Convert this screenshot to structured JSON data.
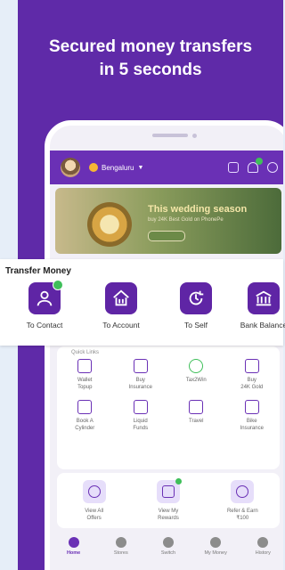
{
  "headline": {
    "line1": "Secured money transfers",
    "line2": "in 5 seconds"
  },
  "phone": {
    "location": "Bengaluru",
    "banner": {
      "title": "This wedding season",
      "subtitle": "buy 24K Best Gold on PhonePe"
    },
    "quick_links_label": "Quick Links",
    "grid_items": [
      {
        "label": "Wallet\nTopup",
        "icon": "wallet-icon"
      },
      {
        "label": "Buy\nInsurance",
        "icon": "shield-icon"
      },
      {
        "label": "Tax2Win",
        "icon": "tax-icon"
      },
      {
        "label": "Buy\n24K Gold",
        "icon": "gold-icon"
      },
      {
        "label": "Book A\nCylinder",
        "icon": "cylinder-icon"
      },
      {
        "label": "Liquid\nFunds",
        "icon": "rupee-icon"
      },
      {
        "label": "Travel",
        "icon": "suitcase-icon"
      },
      {
        "label": "Bike\nInsurance",
        "icon": "bike-icon"
      }
    ],
    "offers": [
      {
        "label": "View All\nOffers",
        "icon": "offers-icon"
      },
      {
        "label": "View My\nRewards",
        "icon": "gift-icon"
      },
      {
        "label": "Refer & Earn\n₹100",
        "icon": "megaphone-icon"
      }
    ],
    "nav": [
      {
        "label": "Home",
        "active": true
      },
      {
        "label": "Stores",
        "active": false
      },
      {
        "label": "Switch",
        "active": false
      },
      {
        "label": "My Money",
        "active": false
      },
      {
        "label": "History",
        "active": false
      }
    ]
  },
  "transfer": {
    "title": "Transfer Money",
    "items": [
      {
        "label": "To Contact",
        "icon": "contact-icon"
      },
      {
        "label": "To Account",
        "icon": "bank-home-icon"
      },
      {
        "label": "To Self",
        "icon": "self-transfer-icon"
      },
      {
        "label": "Bank Balance",
        "icon": "bank-icon"
      }
    ]
  },
  "colors": {
    "brand": "#5f2aa8",
    "accent_green": "#3fbf5a"
  }
}
